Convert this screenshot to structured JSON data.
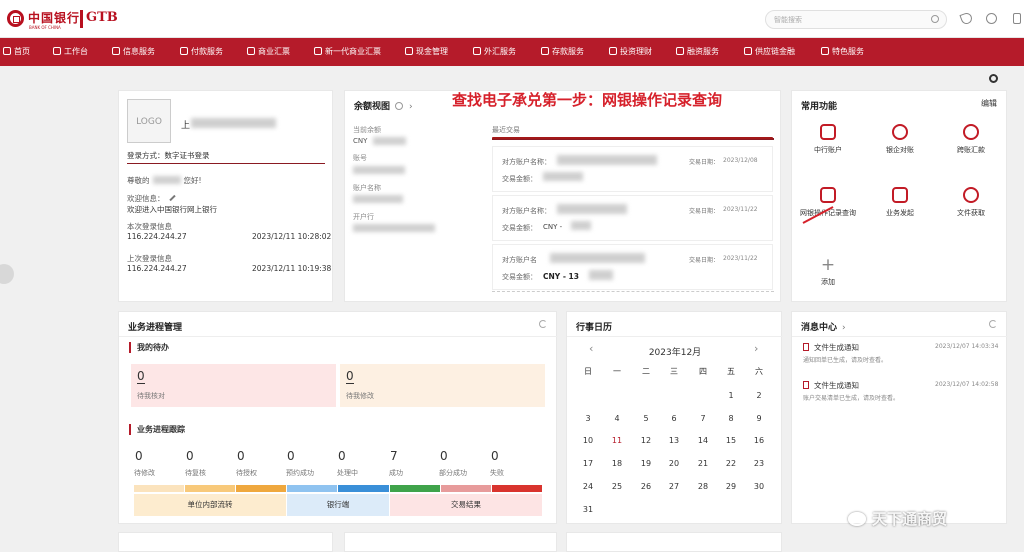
{
  "header": {
    "bank_name": "中国银行",
    "bank_name_en": "BANK OF CHINA",
    "product": "GTB",
    "search_placeholder": "智能搜索"
  },
  "nav": [
    {
      "label": "首页"
    },
    {
      "label": "工作台"
    },
    {
      "label": "信息服务"
    },
    {
      "label": "付款服务"
    },
    {
      "label": "商业汇票"
    },
    {
      "label": "新一代商业汇票"
    },
    {
      "label": "现金管理"
    },
    {
      "label": "外汇服务"
    },
    {
      "label": "存款服务"
    },
    {
      "label": "投资理财"
    },
    {
      "label": "融资服务"
    },
    {
      "label": "供应链金融"
    },
    {
      "label": "特色服务"
    }
  ],
  "profile": {
    "logo_text": "LOGO",
    "company_prefix": "上",
    "login_method": "登录方式：数字证书登录",
    "greeting_prefix": "尊敬的",
    "greeting_suffix": "您好!",
    "welcome_label": "欢迎信息：",
    "welcome_text": "欢迎进入中国银行网上银行",
    "this_login_label": "本次登录信息",
    "this_ip": "116.224.244.27",
    "this_time": "2023/12/11 10:28:02",
    "last_login_label": "上次登录信息",
    "last_ip": "116.224.244.27",
    "last_time": "2023/12/11 10:19:38"
  },
  "balance": {
    "title": "余额视图",
    "current_label": "当前余额",
    "currency": "CNY",
    "account_label": "账号",
    "account_name_label": "账户名称",
    "bank_label": "开户行",
    "recent_label": "最近交易",
    "transactions": [
      {
        "counterparty_label": "对方账户名称：",
        "date_label": "交易日期：",
        "date": "2023/12/08",
        "amount_label": "交易金额：",
        "amount": ""
      },
      {
        "counterparty_label": "对方账户名称：",
        "date_label": "交易日期：",
        "date": "2023/11/22",
        "amount_label": "交易金额：",
        "amount": "CNY -"
      },
      {
        "counterparty_label": "对方账户名",
        "date_label": "交易日期：",
        "date": "2023/11/22",
        "amount_label": "交易金额：",
        "amount": "CNY - 13"
      }
    ]
  },
  "annotation": {
    "text": "查找电子承兑第一步：网银操作记录查询"
  },
  "quick": {
    "title": "常用功能",
    "edit": "编辑",
    "items": [
      {
        "label": "中行账户"
      },
      {
        "label": "银企对账"
      },
      {
        "label": "跨账汇款"
      },
      {
        "label": "网银操作记录查询"
      },
      {
        "label": "业务发起"
      },
      {
        "label": "文件获取"
      },
      {
        "label": "添加"
      }
    ]
  },
  "progress": {
    "title": "业务进程管理",
    "todo_title": "我的待办",
    "todos": [
      {
        "value": "0",
        "label": "待我核对"
      },
      {
        "value": "0",
        "label": "待我修改"
      }
    ],
    "tracking_title": "业务进程跟踪",
    "stages": [
      {
        "value": "0",
        "label": "待修改"
      },
      {
        "value": "0",
        "label": "待复核"
      },
      {
        "value": "0",
        "label": "待授权"
      },
      {
        "value": "0",
        "label": "预约成功"
      },
      {
        "value": "0",
        "label": "处理中"
      },
      {
        "value": "7",
        "label": "成功"
      },
      {
        "value": "0",
        "label": "部分成功"
      },
      {
        "value": "0",
        "label": "失败"
      }
    ],
    "groups": [
      {
        "label": "单位内部流转"
      },
      {
        "label": "银行端"
      },
      {
        "label": "交易结果"
      }
    ]
  },
  "calendar": {
    "title": "行事日历",
    "month": "2023年12月",
    "prev": "‹",
    "next": "›",
    "weekdays": [
      "日",
      "一",
      "二",
      "三",
      "四",
      "五",
      "六"
    ],
    "today": "11",
    "days": [
      "",
      "",
      "",
      "",
      "",
      "1",
      "2",
      "3",
      "4",
      "5",
      "6",
      "7",
      "8",
      "9",
      "10",
      "11",
      "12",
      "13",
      "14",
      "15",
      "16",
      "17",
      "18",
      "19",
      "20",
      "21",
      "22",
      "23",
      "24",
      "25",
      "26",
      "27",
      "28",
      "29",
      "30",
      "31"
    ]
  },
  "messages": {
    "title": "消息中心",
    "items": [
      {
        "title": "文件生成通知",
        "time": "2023/12/07 14:03:34",
        "desc": "通知回单已生成，请及时查看。"
      },
      {
        "title": "文件生成通知",
        "time": "2023/12/07 14:02:58",
        "desc": "账户交易清单已生成，请及时查看。"
      }
    ]
  },
  "watermark": {
    "text": "天下通商贸"
  }
}
